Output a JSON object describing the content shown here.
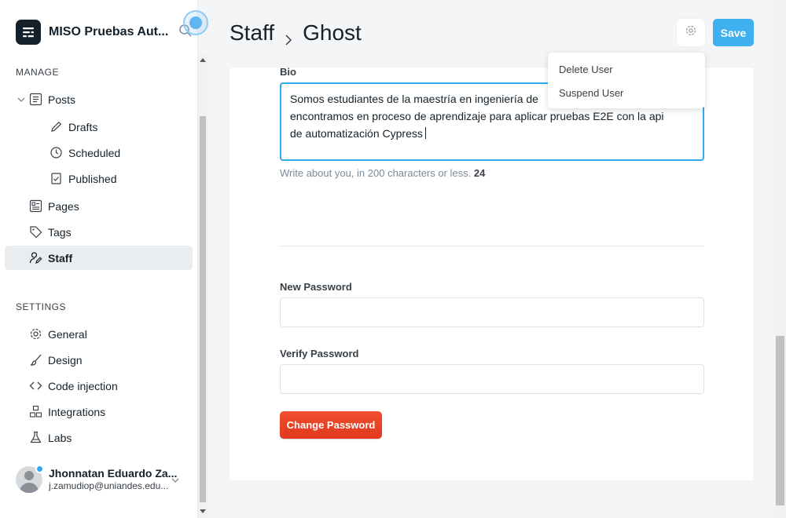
{
  "sidebar": {
    "brand_title": "MISO Pruebas Aut...",
    "manage_heading": "MANAGE",
    "settings_heading": "SETTINGS",
    "items": {
      "posts": "Posts",
      "drafts": "Drafts",
      "scheduled": "Scheduled",
      "published": "Published",
      "pages": "Pages",
      "tags": "Tags",
      "staff": "Staff",
      "general": "General",
      "design": "Design",
      "code_injection": "Code injection",
      "integrations": "Integrations",
      "labs": "Labs"
    },
    "user": {
      "name": "Jhonnatan Eduardo Za...",
      "email": "j.zamudiop@uniandes.edu..."
    }
  },
  "header": {
    "breadcrumb_parent": "Staff",
    "breadcrumb_current": "Ghost",
    "save_label": "Save"
  },
  "dropdown": {
    "delete_user": "Delete User",
    "suspend_user": "Suspend User"
  },
  "form": {
    "bio_label": "Bio",
    "bio_value": "Somos estudiantes de la maestría en ingeniería de s... encontramos en proceso de aprendizaje para aplicar pruebas E2E con la api de automatización Cypress",
    "bio_line1": "Somos estudiantes de la maestría en ingeniería de",
    "bio_line2": "encontramos en proceso de aprendizaje para aplicar pruebas E2E con la api",
    "bio_line3": "de automatización Cypress",
    "bio_hint": "Write about you, in 200 characters or less.",
    "bio_count": "24",
    "new_password_label": "New Password",
    "verify_password_label": "Verify Password",
    "change_password_label": "Change Password"
  },
  "colors": {
    "accent": "#30a9f1",
    "save": "#3eb0ef",
    "danger": "#e5422a"
  }
}
